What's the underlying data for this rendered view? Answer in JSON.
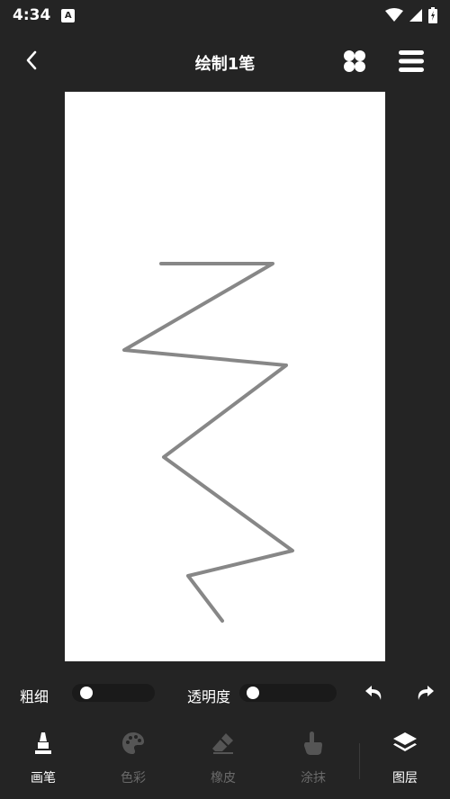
{
  "status_bar": {
    "time": "4:34",
    "notification_badge": "A"
  },
  "header": {
    "title": "绘制1笔"
  },
  "controls": {
    "thickness_label": "粗细",
    "thickness_value": 0,
    "opacity_label": "透明度",
    "opacity_value": 0
  },
  "toolbar": {
    "tools": [
      {
        "label": "画笔",
        "icon": "marker-icon",
        "active": true
      },
      {
        "label": "色彩",
        "icon": "palette-icon",
        "active": false
      },
      {
        "label": "橡皮",
        "icon": "eraser-icon",
        "active": false
      },
      {
        "label": "涂抹",
        "icon": "smudge-finger-icon",
        "active": false
      },
      {
        "label": "图层",
        "icon": "layers-icon",
        "active": true
      }
    ]
  },
  "colors": {
    "background": "#242424",
    "canvas": "#ffffff",
    "stroke": "#7a7a7a",
    "inactive_text": "#6a6a6a"
  }
}
